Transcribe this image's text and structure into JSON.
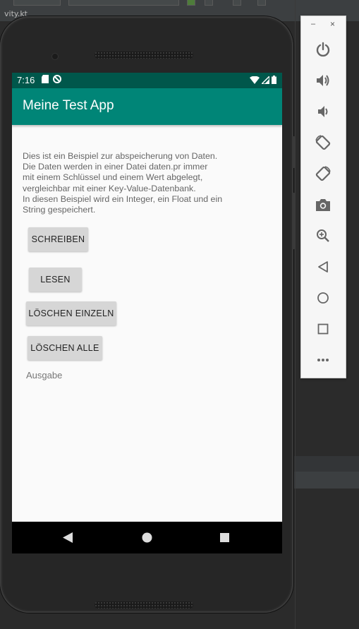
{
  "ide": {
    "tab_label": "vity.kt"
  },
  "status_bar": {
    "time": "7:16"
  },
  "app_bar": {
    "title": "Meine Test App"
  },
  "content": {
    "description": "Dies ist ein Beispiel zur abspeicherung von Daten.\nDie Daten werden in einer Datei daten.pr immer\nmit einem Schlüssel und einem Wert abgelegt,\nvergleichbar mit einer Key-Value-Datenbank.\n In diesen Beispiel wird ein Integer, ein Float und ein\nString gespeichert.",
    "buttons": {
      "schreiben": "SCHREIBEN",
      "lesen": "LESEN",
      "loeschen_einzeln": "LÖSCHEN EINZELN",
      "loeschen_alle": "LÖSCHEN ALLE"
    },
    "output_label": "Ausgabe"
  },
  "nav_bar": {
    "icons": [
      "back-icon",
      "home-icon",
      "recents-icon"
    ]
  },
  "emulator_toolbar": {
    "minimize_label": "–",
    "close_label": "×",
    "icons": [
      "power-icon",
      "volume-up-icon",
      "volume-down-icon",
      "rotate-left-icon",
      "rotate-right-icon",
      "camera-icon",
      "zoom-icon",
      "back-icon",
      "home-icon",
      "overview-icon",
      "more-icon"
    ]
  },
  "colors": {
    "primary": "#008577",
    "primary_dark": "#00574b",
    "ide_background": "#2b2b2b"
  }
}
